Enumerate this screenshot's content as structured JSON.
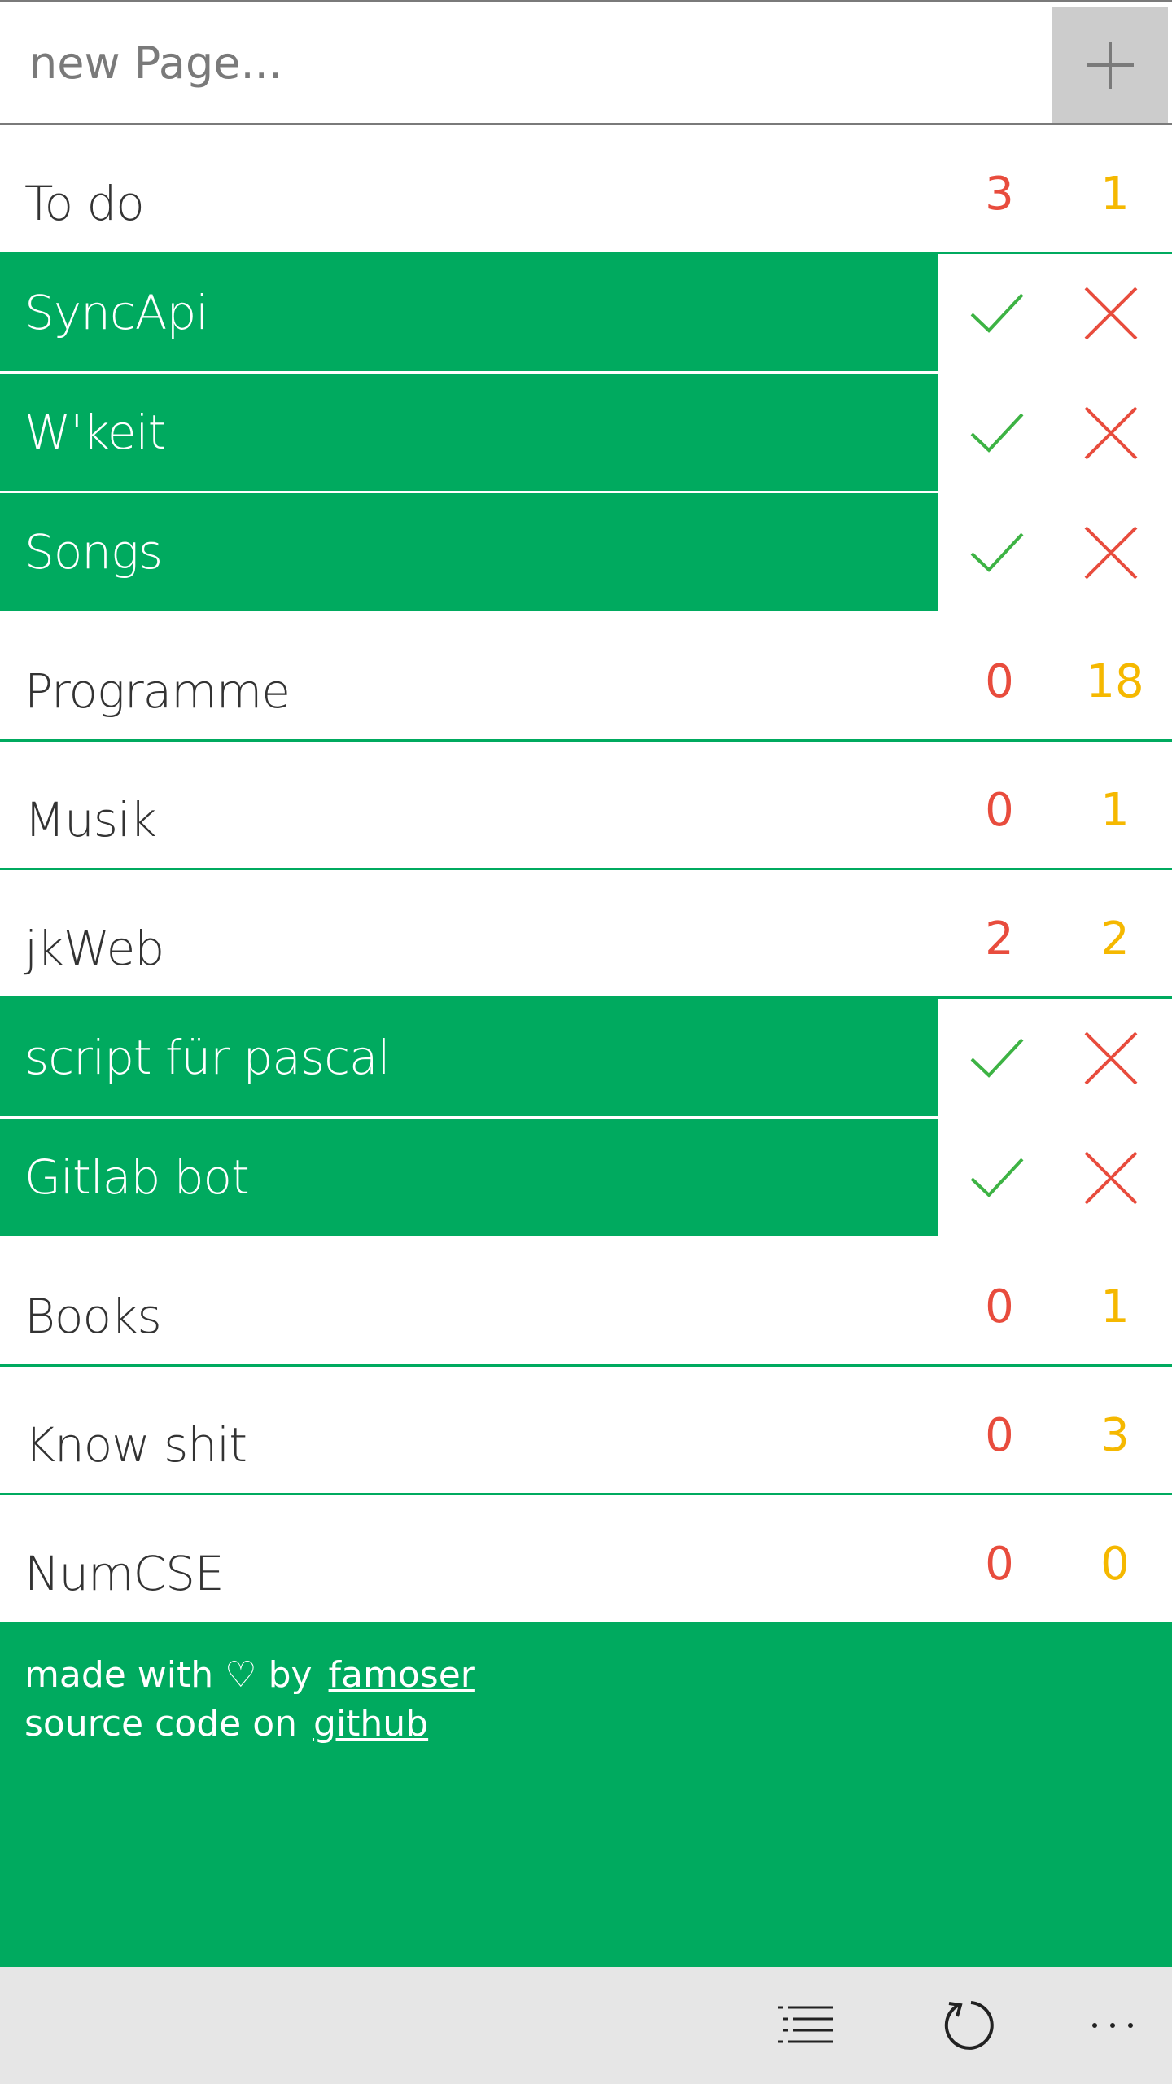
{
  "new_page": {
    "placeholder": "new Page..."
  },
  "add_button": {
    "icon": "plus-icon"
  },
  "pages": [
    {
      "title": "To do",
      "red_count": "3",
      "yellow_count": "1",
      "count_offset": 0,
      "todos": [
        {
          "title": "SyncApi"
        },
        {
          "title": "W'keit"
        },
        {
          "title": "Songs"
        }
      ]
    },
    {
      "title": "Programme",
      "red_count": "0",
      "yellow_count": "18",
      "todos": []
    },
    {
      "title": "Musik",
      "red_count": "0",
      "yellow_count": "1",
      "todos": []
    },
    {
      "title": "jkWeb",
      "red_count": "2",
      "yellow_count": "2",
      "todos": [
        {
          "title": "script für pascal"
        },
        {
          "title": "Gitlab bot"
        }
      ]
    },
    {
      "title": "Books",
      "red_count": "0",
      "yellow_count": "1",
      "todos": []
    },
    {
      "title": "Know shit",
      "red_count": "0",
      "yellow_count": "3",
      "todos": []
    },
    {
      "title": "NumCSE",
      "red_count": "0",
      "yellow_count": "0",
      "todos": []
    }
  ],
  "footer": {
    "made_with": "made with ♡ by",
    "author_link": "famoser",
    "source_text": "source code on",
    "source_link": "github"
  },
  "app_bar": {
    "buttons": [
      "list-icon",
      "refresh-icon",
      "more-icon"
    ]
  },
  "colors": {
    "accent": "#00aa5f",
    "red": "#e84c3d",
    "yellow": "#f5b800",
    "appbar": "#e6e6e6"
  }
}
